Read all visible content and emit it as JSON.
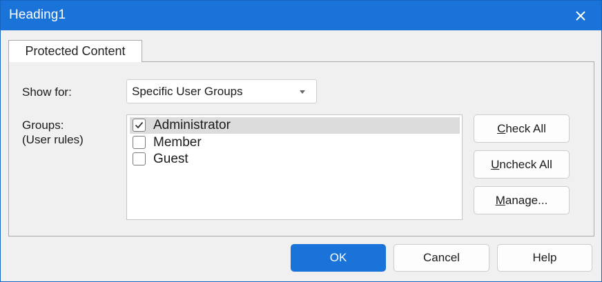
{
  "window": {
    "title": "Heading1"
  },
  "tab": {
    "label": "Protected Content"
  },
  "show_for": {
    "label": "Show for:",
    "selected": "Specific User Groups"
  },
  "groups": {
    "label_line1": "Groups:",
    "label_line2": "(User rules)",
    "items": [
      {
        "label": "Administrator",
        "checked": true,
        "selected": true
      },
      {
        "label": "Member",
        "checked": false,
        "selected": false
      },
      {
        "label": "Guest",
        "checked": false,
        "selected": false
      }
    ]
  },
  "side_buttons": {
    "check_all": {
      "accel": "C",
      "rest": "heck All"
    },
    "uncheck_all": {
      "accel": "U",
      "rest": "ncheck All"
    },
    "manage": {
      "accel": "M",
      "rest": "anage..."
    }
  },
  "footer": {
    "ok": "OK",
    "cancel": "Cancel",
    "help": "Help"
  },
  "colors": {
    "accent": "#1a73d9",
    "selection": "#dcdcdc"
  }
}
